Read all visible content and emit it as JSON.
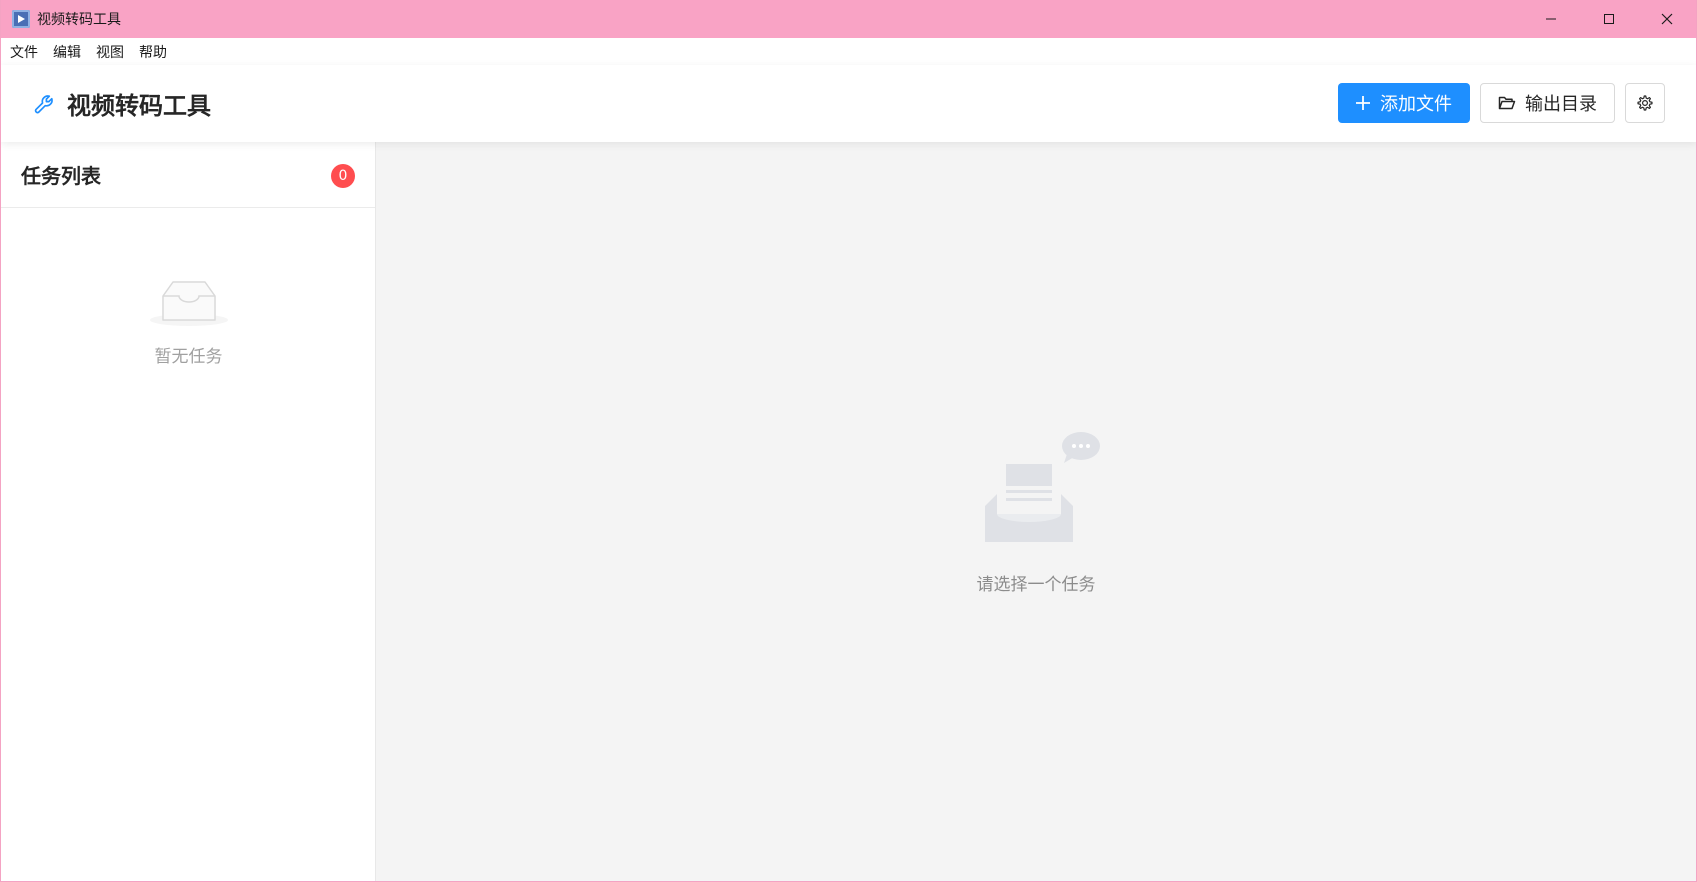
{
  "window": {
    "title": "视频转码工具",
    "controls": [
      "minimize-icon",
      "maximize-icon",
      "close-icon"
    ]
  },
  "menu": {
    "items": [
      {
        "label": "文件"
      },
      {
        "label": "编辑"
      },
      {
        "label": "视图"
      },
      {
        "label": "帮助"
      }
    ]
  },
  "header": {
    "title": "视频转码工具",
    "icon": "wrench-icon",
    "add_file_label": "添加文件",
    "output_dir_label": "输出目录",
    "settings_icon": "gear-icon"
  },
  "sidebar": {
    "title": "任务列表",
    "count": "0",
    "empty_text": "暂无任务"
  },
  "main": {
    "empty_text": "请选择一个任务"
  },
  "colors": {
    "titlebar": "#f9a3c5",
    "primary": "#1e8fff",
    "badge": "#ff4d4f",
    "main_bg": "#f4f4f4"
  }
}
